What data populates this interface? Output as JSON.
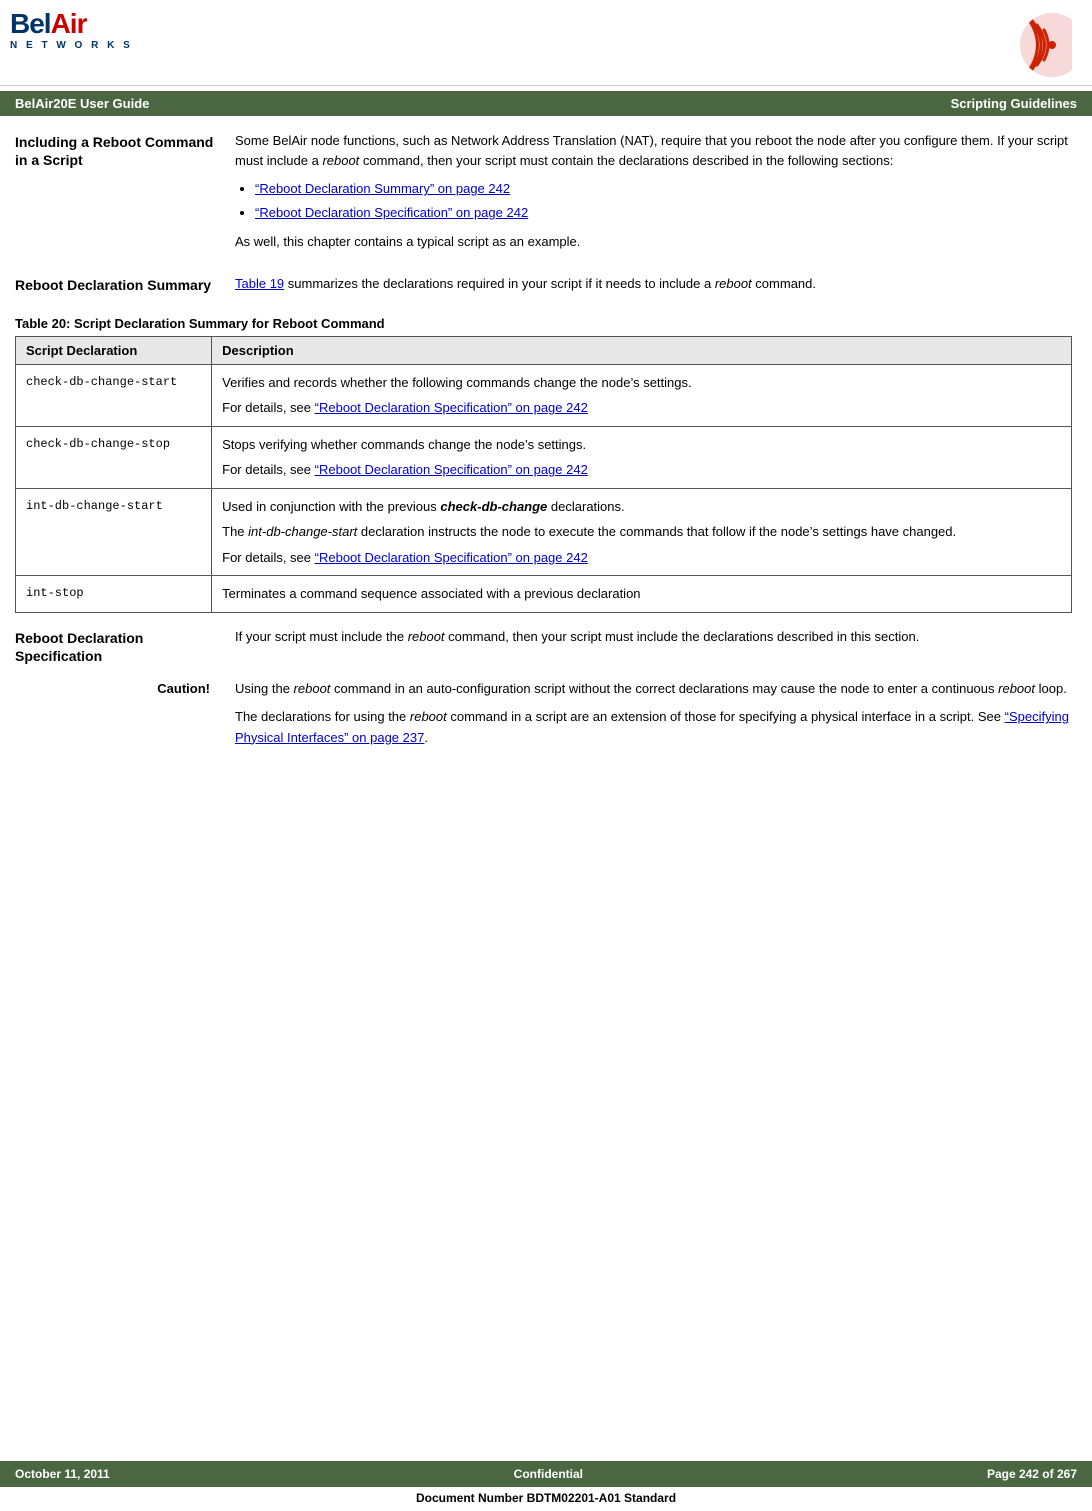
{
  "header": {
    "logo_bel": "Bel",
    "logo_air": "Air",
    "logo_networks": "N E T W O R K S",
    "title_left": "BelAir20E User Guide",
    "title_right": "Scripting Guidelines"
  },
  "section_including": {
    "label": "Including a Reboot Command in a Script",
    "intro": "Some BelAir node functions, such as Network Address Translation (NAT), require that you reboot the node after you configure them. If your script must include a reboot command, then your script must contain the declarations described in the following sections:",
    "bullet1": "“Reboot Declaration Summary” on page 242",
    "bullet2": "“Reboot Declaration Specification” on page 242",
    "conclusion": "As well, this chapter contains a typical script as an example."
  },
  "section_summary": {
    "label": "Reboot Declaration Summary",
    "text_before_link": "Table 19",
    "text_after_link": " summarizes the declarations required in your script if it needs to include a ",
    "reboot_word": "reboot",
    "text_end": " command."
  },
  "table": {
    "title": "Table 20: Script Declaration Summary for Reboot Command",
    "col1": "Script Declaration",
    "col2": "Description",
    "rows": [
      {
        "code": "check-db-change-start",
        "desc_main": "Verifies and records whether the following commands change the node’s settings.",
        "desc_link_prefix": "For details, see ",
        "desc_link": "“Reboot Declaration Specification” on page 242"
      },
      {
        "code": "check-db-change-stop",
        "desc_main": "Stops verifying whether commands change the node’s settings.",
        "desc_link_prefix": "For details, see ",
        "desc_link": "“Reboot Declaration Specification” on page 242"
      },
      {
        "code": "int-db-change-start",
        "desc_line1": "Used in conjunction with the previous check-db-change declarations.",
        "desc_line2_prefix": "The ",
        "desc_line2_italic": "int-db-change-start",
        "desc_line2_suffix": " declaration instructs the node to execute the commands that follow if the node’s settings have changed.",
        "desc_link_prefix": "For details, see ",
        "desc_link": "“Reboot Declaration Specification” on page 242"
      },
      {
        "code": "int-stop",
        "desc_main": "Terminates a command sequence associated with a previous declaration"
      }
    ]
  },
  "section_specification": {
    "label": "Reboot Declaration Specification",
    "text": "If your script must include the ",
    "reboot_word": "reboot",
    "text2": " command, then your script must include the declarations described in this section."
  },
  "section_caution": {
    "label": "Caution!",
    "line1_prefix": "Using the ",
    "line1_italic": "reboot",
    "line1_suffix": " command in an auto-configuration script without the correct declarations may cause the node to enter a continuous ",
    "line1_italic2": "reboot",
    "line1_end": " loop.",
    "line2_prefix": "The declarations for using the ",
    "line2_italic": "reboot",
    "line2_suffix": " command in a script are an extension of those for specifying a physical interface in a script. See ",
    "line2_link": "“Specifying Physical Interfaces” on page 237",
    "line2_end": "."
  },
  "footer": {
    "left": "October 11, 2011",
    "center": "Confidential",
    "right": "Page 242 of 267",
    "doc_number": "Document Number BDTM02201-A01 Standard"
  }
}
